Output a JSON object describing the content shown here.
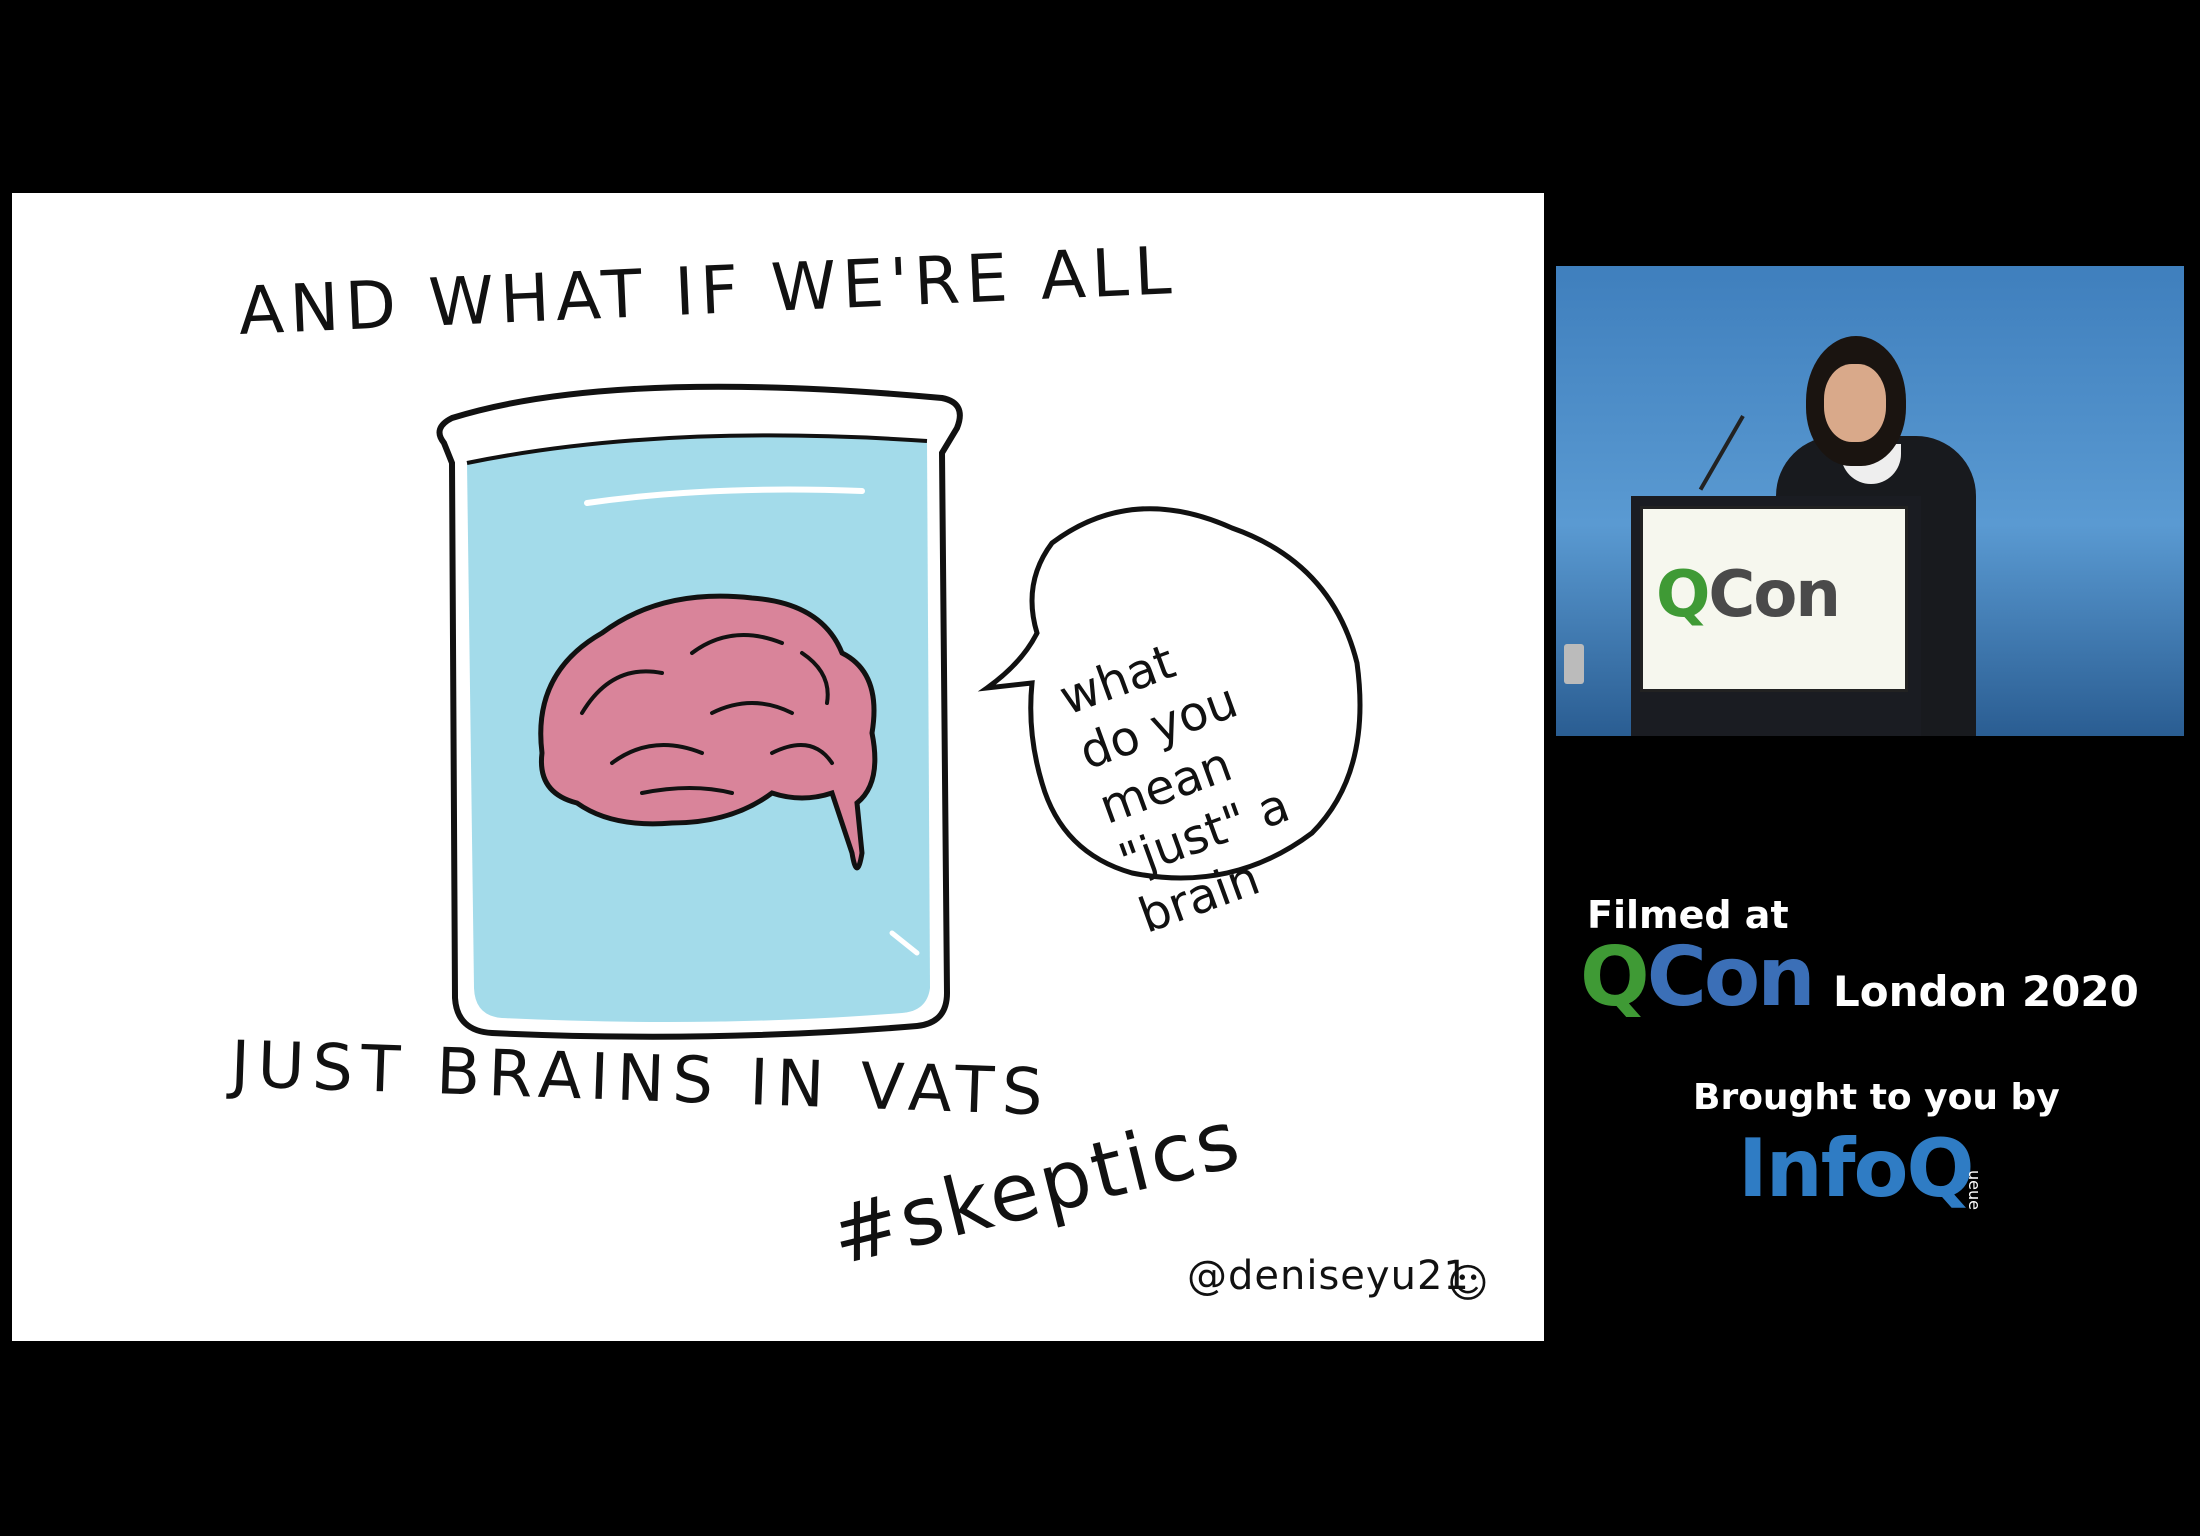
{
  "slide": {
    "heading_top": "AND WHAT IF WE'RE ALL",
    "heading_bottom": "JUST BRAINS IN VATS",
    "hashtag": "#skeptics",
    "credit": "@deniseyu21",
    "bubble_lines": [
      "what",
      "do you",
      "mean",
      "\"just\" a",
      "brain"
    ]
  },
  "video": {
    "podium_logo_q": "Q",
    "podium_logo_rest": "Con"
  },
  "branding": {
    "filmed_at": "Filmed at",
    "qcon_q": "Q",
    "qcon_rest": "Con",
    "event": "London 2020",
    "brought_to_you_by": "Brought to you by",
    "infoq_text": "Info",
    "infoq_q": "Q",
    "queue": "ueue"
  },
  "colors": {
    "background": "#000000",
    "slide": "#ffffff",
    "water": "#a3dbea",
    "brain": "#d9849a",
    "qcon_green": "#3f9a35",
    "qcon_blue": "#3b6fb7",
    "infoq_blue": "#2f7cc4"
  }
}
